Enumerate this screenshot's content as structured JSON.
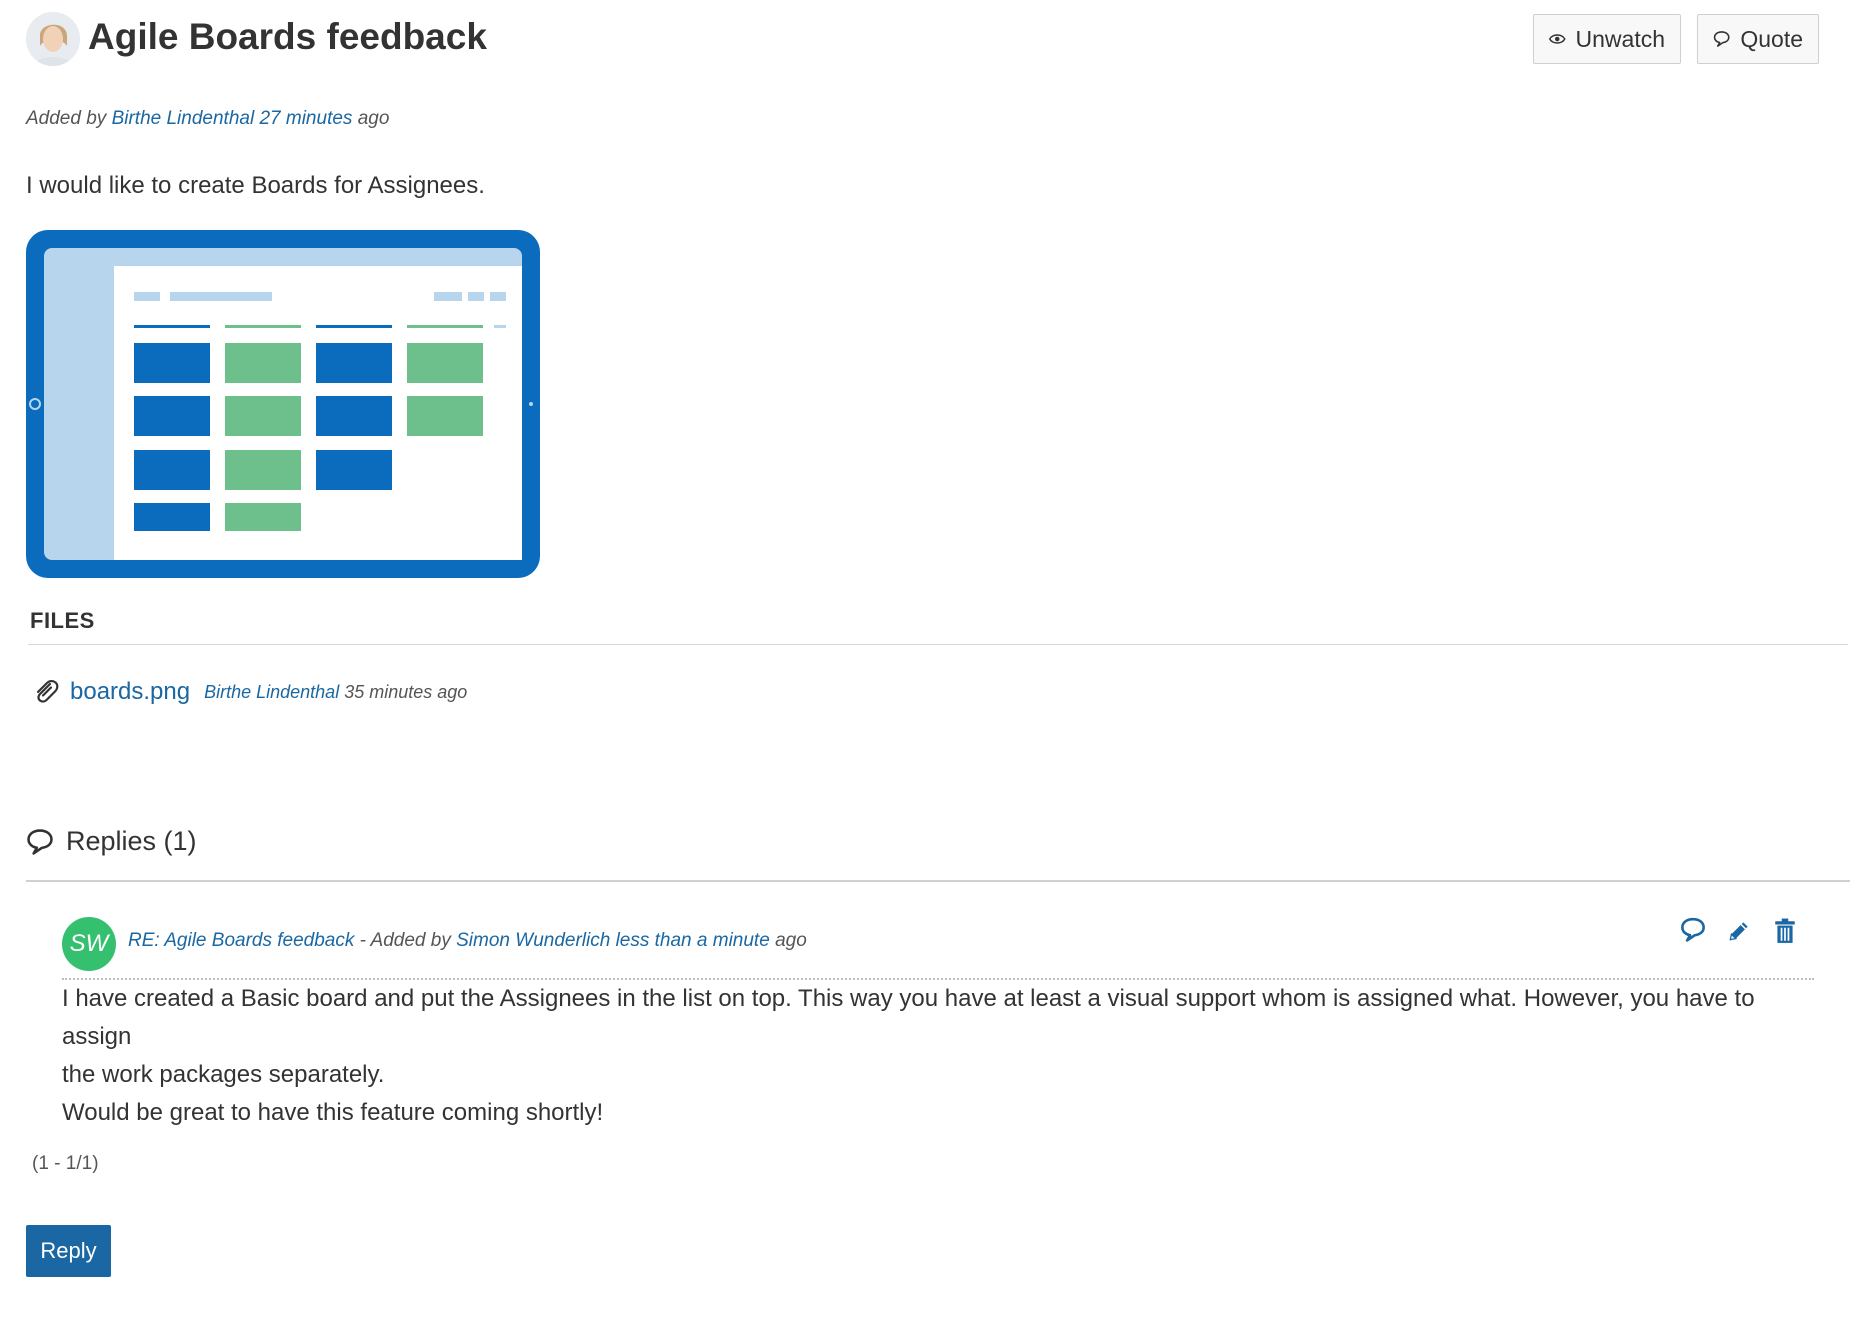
{
  "message": {
    "title": "Agile Boards feedback",
    "meta": {
      "prefix": "Added by",
      "author": "Birthe Lindenthal",
      "time": "27 minutes",
      "suffix": "ago"
    },
    "body": "I would like to create Boards for Assignees."
  },
  "header_buttons": {
    "unwatch_label": "Unwatch",
    "quote_label": "Quote"
  },
  "files": {
    "heading": "FILES",
    "items": [
      {
        "name": "boards.png",
        "author": "Birthe Lindenthal",
        "time": "35 minutes ago"
      }
    ]
  },
  "replies": {
    "heading": "Replies (1)",
    "items": [
      {
        "initials": "SW",
        "subject": "RE: Agile Boards feedback",
        "separator": " - Added by ",
        "author": "Simon Wunderlich",
        "time": "less than a minute",
        "suffix": "ago",
        "body_lines": [
          "I have created a Basic board and put the Assignees in the list on top. This way you have at least a visual support whom is assigned what. However, you have to assign",
          "the work packages separately.",
          "Would be great to have this feature coming shortly!"
        ]
      }
    ],
    "pagination": "(1 - 1/1)"
  },
  "reply_button_label": "Reply",
  "icons": {
    "watch": "eye-icon",
    "quote": "speech-bubble-icon",
    "attachment": "paperclip-icon",
    "replies": "speech-bubble-icon",
    "reply_quote": "speech-bubble-icon",
    "reply_edit": "pencil-icon",
    "reply_delete": "trash-icon"
  },
  "colors": {
    "link": "#1a67a3",
    "primary_button": "#1a67a3",
    "reply_avatar": "#35c070",
    "board_blue": "#0b6bbd",
    "board_green": "#6dbf8c"
  }
}
